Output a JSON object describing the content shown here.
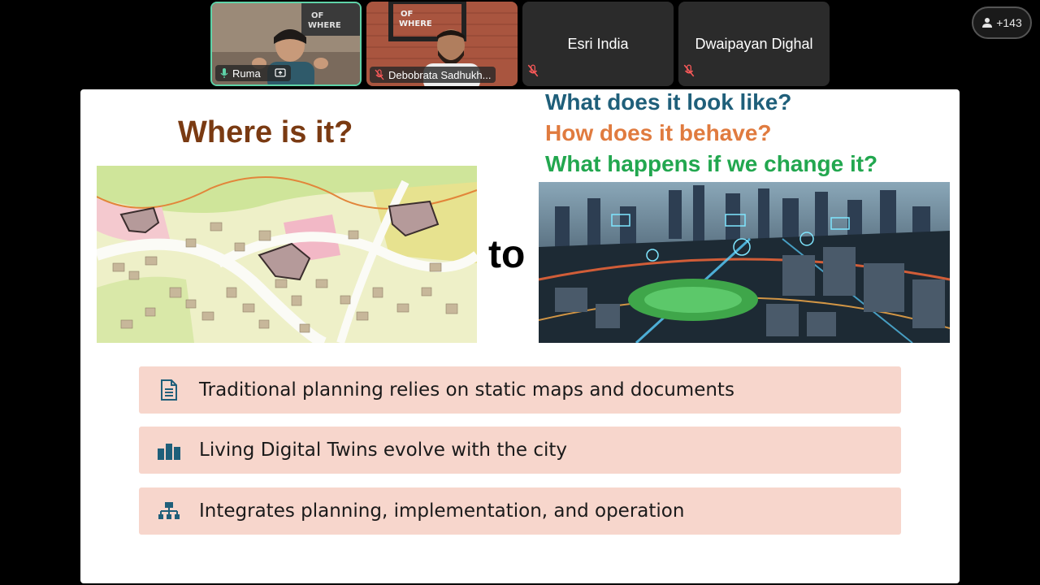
{
  "participants": [
    {
      "name": "Ruma",
      "mic": "on",
      "sharing": true
    },
    {
      "name": "Debobrata Sadhukh...",
      "mic": "muted"
    },
    {
      "name": "Esri India",
      "mic": "muted"
    },
    {
      "name": "Dwaipayan Dighal",
      "mic": "muted"
    }
  ],
  "participant_count": "+143",
  "slide": {
    "left_heading": "Where is it?",
    "questions": [
      "What does it look like?",
      "How does it behave?",
      "What happens if we change it?"
    ],
    "connector": "to",
    "bullets": [
      {
        "text": "Traditional planning relies on static maps and documents",
        "icon": "document-icon"
      },
      {
        "text": "Living Digital Twins evolve with the city",
        "icon": "bar-buildings-icon"
      },
      {
        "text": "Integrates planning, implementation, and operation",
        "icon": "hierarchy-icon"
      }
    ]
  },
  "colors": {
    "active_speaker_border": "#5fd3a8",
    "heading_brown": "#7a3a12",
    "q_blue": "#1f5f7a",
    "q_orange": "#e07b3f",
    "q_green": "#22a74f",
    "bullet_bg": "#f7d6cc",
    "icon_teal": "#1f5f7a"
  }
}
